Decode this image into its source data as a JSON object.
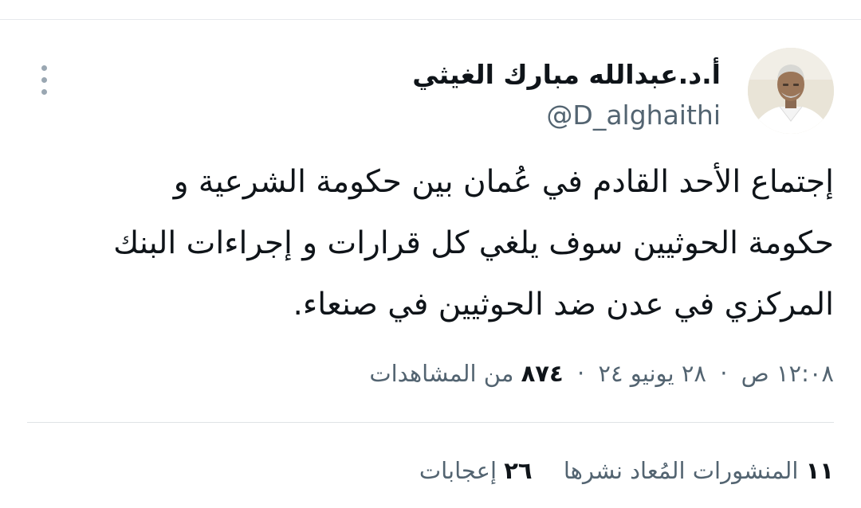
{
  "tweet": {
    "author": {
      "display_name": "أ.د.عبدالله مبارك الغيثي",
      "handle": "@D_alghaithi",
      "avatar": "profile-photo"
    },
    "more_icon": "more-vertical-icon",
    "text": "إجتماع الأحد القادم في عُمان بين حكومة الشرعية و\nحكومة الحوثيين سوف يلغي كل قرارات و إجراءات البنك\nالمركزي في عدن ضد الحوثيين في صنعاء.",
    "meta": {
      "time": "١٢:٠٨ ص",
      "date": "٢٨ يونيو ٢٤",
      "separator": "·",
      "views_count": "٨٧٤",
      "views_label": "من المشاهدات"
    },
    "stats": {
      "reposts_count": "١١",
      "reposts_label": "المنشورات المُعاد نشرها",
      "likes_count": "٢٦",
      "likes_label": "إعجابات"
    }
  }
}
